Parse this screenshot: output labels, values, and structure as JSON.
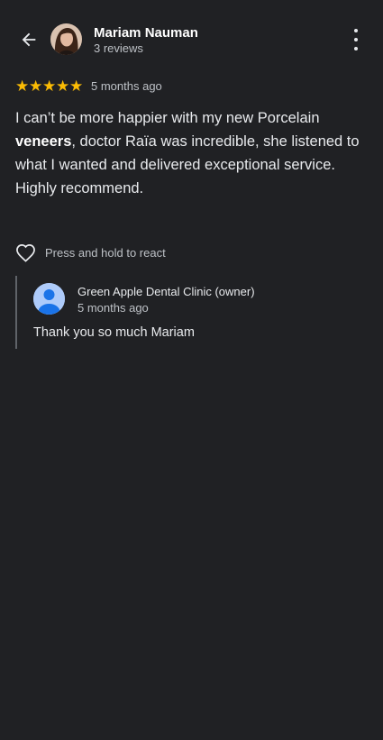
{
  "header": {
    "reviewer_name": "Mariam Nauman",
    "reviewer_reviews": "3 reviews"
  },
  "review": {
    "rating": 5,
    "stars": [
      "★",
      "★",
      "★",
      "★",
      "★"
    ],
    "time": "5 months ago",
    "text_part1": "I can’t be more happier with my new Porcelain ",
    "text_bold": "veneers",
    "text_part2": ", doctor Raïa was incredible, she listened to what I wanted and delivered exceptional service.",
    "text_part3": "Highly recommend."
  },
  "react": {
    "label": "Press and hold to react"
  },
  "owner_reply": {
    "name": "Green Apple Dental Clinic (owner)",
    "time": "5 months ago",
    "text": "Thank you so much Mariam"
  },
  "colors": {
    "background": "#202124",
    "star": "#fbbc04",
    "owner_avatar": "#aecbfa"
  }
}
